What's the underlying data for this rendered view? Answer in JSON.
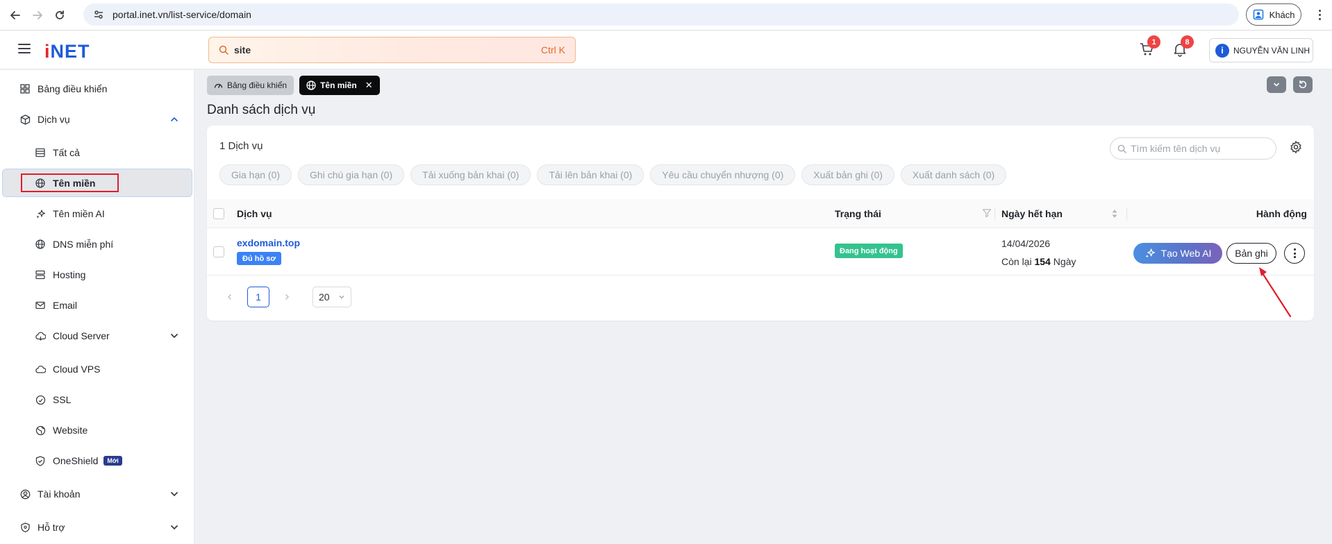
{
  "browser": {
    "url": "portal.inet.vn/list-service/domain",
    "guest_label": "Khách"
  },
  "header": {
    "logo": "iNET",
    "search_value": "site",
    "search_shortcut": "Ctrl K",
    "cart_count": "1",
    "notification_count": "8",
    "user_name": "NGUYỄN VĂN LINH"
  },
  "sidebar": {
    "items": [
      {
        "label": "Bảng điều khiển",
        "icon": "dashboard-grid-icon"
      },
      {
        "label": "Dịch vụ",
        "icon": "package-icon"
      },
      {
        "label": "Tất cả",
        "icon": "list-icon"
      },
      {
        "label": "Tên miền",
        "icon": "globe-icon"
      },
      {
        "label": "Tên miền AI",
        "icon": "sparkle-icon"
      },
      {
        "label": "DNS miễn phí",
        "icon": "globe-icon"
      },
      {
        "label": "Hosting",
        "icon": "server-icon"
      },
      {
        "label": "Email",
        "icon": "mail-icon"
      },
      {
        "label": "Cloud Server",
        "icon": "cloud-icon"
      },
      {
        "label": "Cloud VPS",
        "icon": "cloud-icon"
      },
      {
        "label": "SSL",
        "icon": "ssl-icon"
      },
      {
        "label": "Website",
        "icon": "website-icon"
      },
      {
        "label": "OneShield",
        "icon": "shield-icon"
      },
      {
        "label": "Tài khoản",
        "icon": "user-circle-icon"
      },
      {
        "label": "Hỗ trợ",
        "icon": "support-icon"
      }
    ],
    "new_badge": "Mới"
  },
  "tabs": {
    "dashboard": "Bảng điều khiển",
    "domain": "Tên miền",
    "close": "✕"
  },
  "main": {
    "title": "Danh sách dịch vụ",
    "count_label": "1 Dịch vụ",
    "search_placeholder": "Tìm kiếm tên dịch vụ",
    "actions": [
      "Gia hạn (0)",
      "Ghi chú gia hạn (0)",
      "Tải xuống bản khai (0)",
      "Tải lên bản khai (0)",
      "Yêu cầu chuyển nhượng (0)",
      "Xuất bản ghi (0)",
      "Xuất danh sách (0)"
    ],
    "columns": {
      "service": "Dịch vụ",
      "status": "Trạng thái",
      "expiry": "Ngày hết hạn",
      "actions": "Hành động"
    },
    "rows": [
      {
        "domain": "exdomain.top",
        "profile_tag": "Đủ hồ sơ",
        "status": "Đang hoạt động",
        "expiry_date": "14/04/2026",
        "remaining_prefix": "Còn lại",
        "remaining_days": "154",
        "remaining_unit": "Ngày",
        "ai_button": "Tạo Web AI",
        "record_button": "Bản ghi"
      }
    ],
    "pagination": {
      "current_page": "1",
      "page_size": "20"
    }
  },
  "colors": {
    "brand_blue": "#1e5bd8",
    "brand_red": "#e3262f",
    "status_green": "#34c38f",
    "annotation_red": "#e11d2a"
  }
}
